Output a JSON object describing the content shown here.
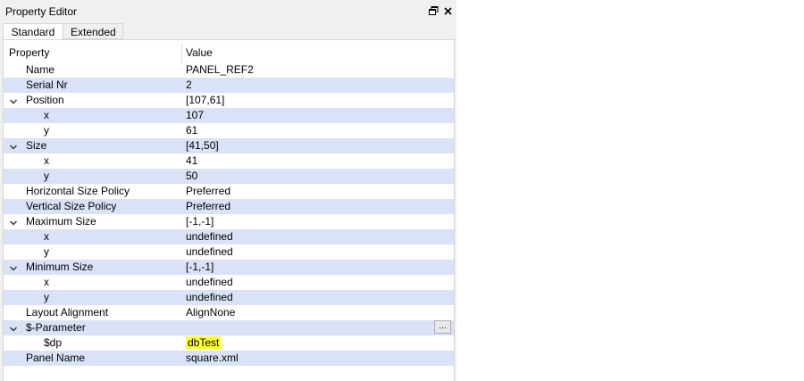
{
  "window": {
    "title": "Property Editor",
    "float_icon": "float-window-icon",
    "close_icon": "close-icon"
  },
  "tabs": [
    {
      "label": "Standard",
      "active": true
    },
    {
      "label": "Extended",
      "active": false
    }
  ],
  "table": {
    "header": {
      "property": "Property",
      "value": "Value"
    },
    "rows": [
      {
        "name": "Name",
        "value": "PANEL_REF2",
        "level": 1,
        "expander": false
      },
      {
        "name": "Serial Nr",
        "value": "2",
        "level": 1,
        "expander": false
      },
      {
        "name": "Position",
        "value": "[107,61]",
        "level": 1,
        "expander": true
      },
      {
        "name": "x",
        "value": "107",
        "level": 2,
        "expander": false
      },
      {
        "name": "y",
        "value": "61",
        "level": 2,
        "expander": false
      },
      {
        "name": "Size",
        "value": "[41,50]",
        "level": 1,
        "expander": true
      },
      {
        "name": "x",
        "value": "41",
        "level": 2,
        "expander": false
      },
      {
        "name": "y",
        "value": "50",
        "level": 2,
        "expander": false
      },
      {
        "name": "Horizontal Size Policy",
        "value": "Preferred",
        "level": 1,
        "expander": false
      },
      {
        "name": "Vertical Size Policy",
        "value": "Preferred",
        "level": 1,
        "expander": false
      },
      {
        "name": "Maximum Size",
        "value": "[-1,-1]",
        "level": 1,
        "expander": true
      },
      {
        "name": "x",
        "value": "undefined",
        "level": 2,
        "expander": false
      },
      {
        "name": "y",
        "value": "undefined",
        "level": 2,
        "expander": false
      },
      {
        "name": "Minimum Size",
        "value": "[-1,-1]",
        "level": 1,
        "expander": true
      },
      {
        "name": "x",
        "value": "undefined",
        "level": 2,
        "expander": false
      },
      {
        "name": "y",
        "value": "undefined",
        "level": 2,
        "expander": false
      },
      {
        "name": "Layout Alignment",
        "value": "AlignNone",
        "level": 1,
        "expander": false
      },
      {
        "name": "$-Parameter",
        "value": "",
        "level": 1,
        "expander": true,
        "button": "..."
      },
      {
        "name": "$dp",
        "value": "dbTest",
        "level": 2,
        "expander": false,
        "highlight": true
      },
      {
        "name": "Panel Name",
        "value": "square.xml",
        "level": 1,
        "expander": false
      }
    ]
  },
  "colors": {
    "alt_row": "#d9e2f6",
    "highlight": "#ffff3c"
  }
}
